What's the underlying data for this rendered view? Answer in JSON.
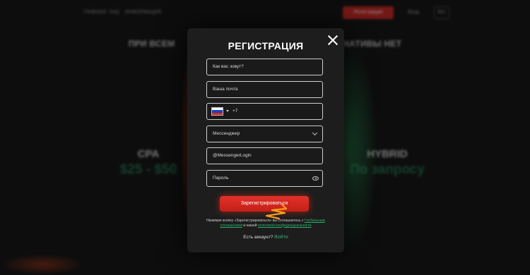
{
  "background": {
    "nav": {
      "link1": "Главная",
      "link2": "FAQ",
      "link3": "Информация",
      "register": "Регистрация",
      "login": "Вход",
      "lang": "RU"
    },
    "heading_left": "ПРИ ВСЕМ",
    "heading_right": "НАТИВЫ НЕТ",
    "plans": [
      {
        "name": "CPA",
        "price": "$25 - $50"
      },
      {
        "name": "HYBRID",
        "price": "По запросу"
      }
    ]
  },
  "modal": {
    "title": "РЕГИСТРАЦИЯ",
    "name_placeholder": "Как вас зовут?",
    "email_placeholder": "Ваша почта",
    "phone_code": "+7",
    "messenger_select": "Мессенджер",
    "messenger_login_placeholder": "@MessengerLogin",
    "password_placeholder": "Пароль",
    "submit_label": "Зарегистрироваться",
    "consent_text_1": "Нажимая кнопку «Зарегистрироваться» вы соглашаетесь с",
    "consent_link_1": "Глобальным соглашением",
    "consent_text_2": "и нашей",
    "consent_link_2": "политикой конфиденциальности",
    "signin_text": "Есть аккаунт?",
    "signin_link": "Войти"
  },
  "colors": {
    "accent_red": "#d52b1e",
    "accent_green": "#2fae6a",
    "modal_bg": "#1d1d1d"
  },
  "icons": [
    "close-icon",
    "russia-flag-icon",
    "chevron-down-icon",
    "eye-icon"
  ]
}
